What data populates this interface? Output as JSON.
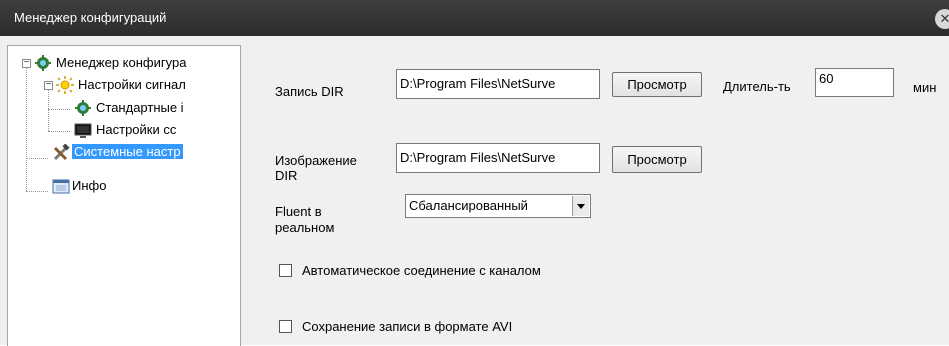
{
  "window": {
    "title": "Менеджер конфигураций",
    "close_glyph": "✕"
  },
  "tree": {
    "items": [
      {
        "label": "Менеджер конфигура",
        "icon": "gear-icon"
      },
      {
        "label": "Настройки сигнал",
        "icon": "alarm-sun-icon"
      },
      {
        "label": "Стандартные і",
        "icon": "gear-icon"
      },
      {
        "label": "Настройки сс",
        "icon": "monitor-icon"
      },
      {
        "label": "Системные настр",
        "icon": "tools-icon",
        "selected": true
      },
      {
        "label": "Инфо",
        "icon": "info-window-icon"
      }
    ]
  },
  "record_dir": {
    "label": "Запись DIR",
    "value": "D:\\Program Files\\NetSurve",
    "browse_label": "Просмотр"
  },
  "duration": {
    "label": "Длитель-ть",
    "value": "60",
    "unit": "мин"
  },
  "image_dir": {
    "label_line1": "Изображение",
    "label_line2": "DIR",
    "value": "D:\\Program Files\\NetSurve",
    "browse_label": "Просмотр"
  },
  "fluent": {
    "label_line1": "Fluent в",
    "label_line2": "реальном",
    "selected": "Сбалансированный"
  },
  "auto_connect": {
    "label": "Автоматическое соединение с каналом",
    "checked": false
  },
  "save_avi": {
    "label": "Сохранение записи в формате AVI",
    "checked": false
  }
}
